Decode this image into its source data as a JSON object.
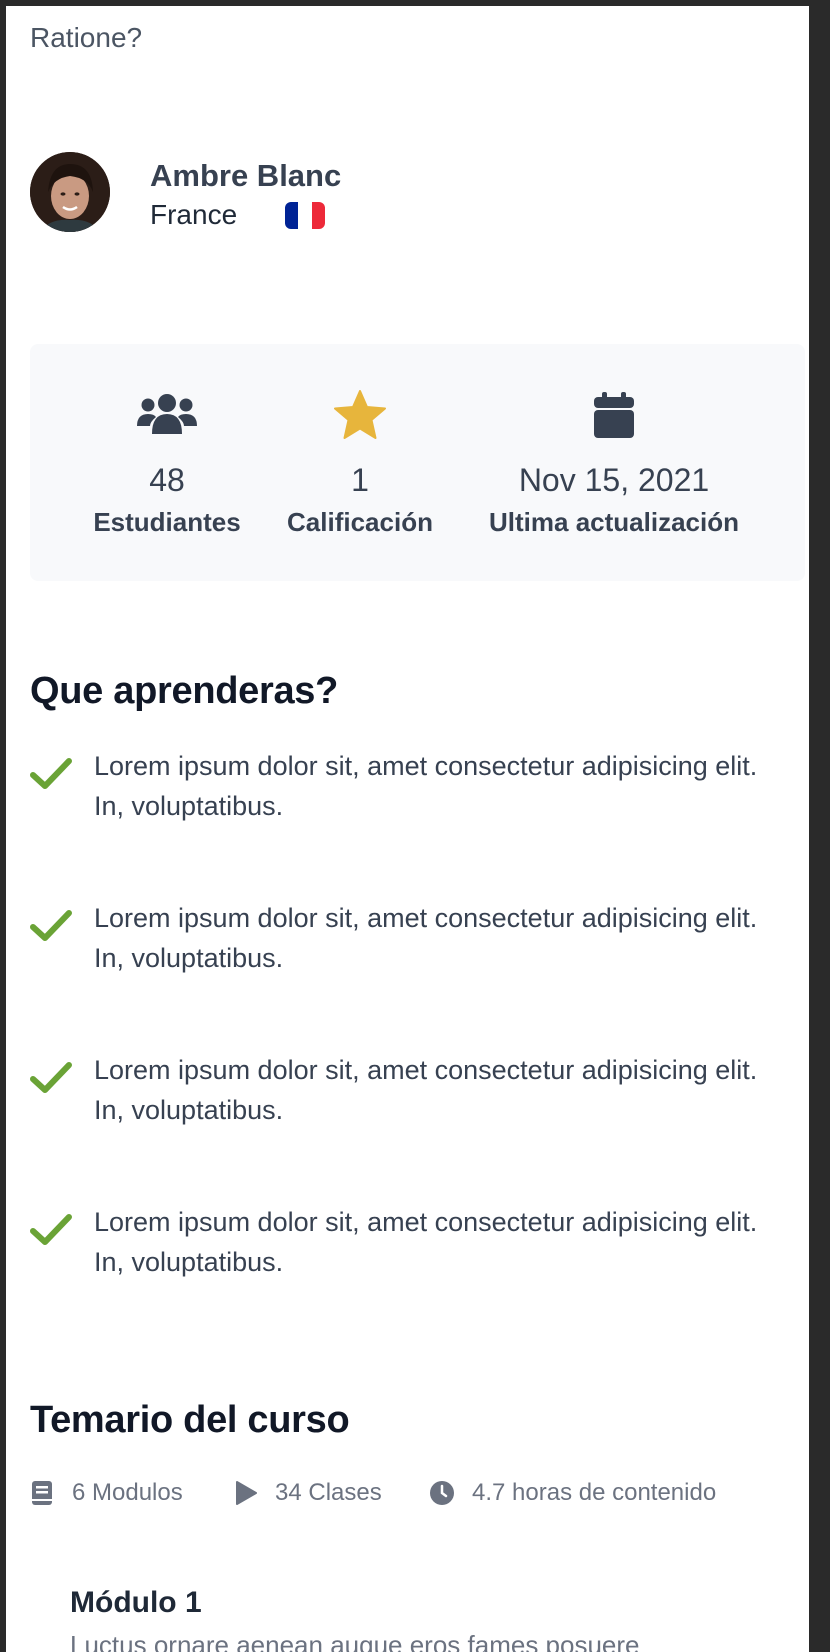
{
  "intro": {
    "text": "asperiores, et explicabo ipsum ex cupiditate aperiam? Ratione?"
  },
  "instructor": {
    "name": "Ambre Blanc",
    "country": "France",
    "flag_colors": [
      "#002395",
      "#ffffff",
      "#ed2939"
    ]
  },
  "stats": [
    {
      "icon": "users-icon",
      "value": "48",
      "label": "Estudiantes"
    },
    {
      "icon": "star-icon",
      "value": "1",
      "label": "Calificación"
    },
    {
      "icon": "calendar-icon",
      "value": "Nov 15, 2021",
      "label": "Ultima actualización"
    }
  ],
  "learn": {
    "title": "Que aprenderas?",
    "items": [
      "Lorem ipsum dolor sit, amet consectetur adipisicing elit. In, voluptatibus.",
      "Lorem ipsum dolor sit, amet consectetur adipisicing elit. In, voluptatibus.",
      "Lorem ipsum dolor sit, amet consectetur adipisicing elit. In, voluptatibus.",
      "Lorem ipsum dolor sit, amet consectetur adipisicing elit. In, voluptatibus."
    ]
  },
  "syllabus": {
    "title": "Temario del curso",
    "modules_count": "6 Modulos",
    "classes_count": "34 Clases",
    "hours": "4.7 horas de contenido",
    "module": {
      "title": "Módulo 1",
      "description": "Luctus ornare aenean augue eros fames posuere"
    }
  },
  "colors": {
    "accent_check": "#6aa336",
    "star": "#e7b53c",
    "icon_dark": "#374151"
  }
}
